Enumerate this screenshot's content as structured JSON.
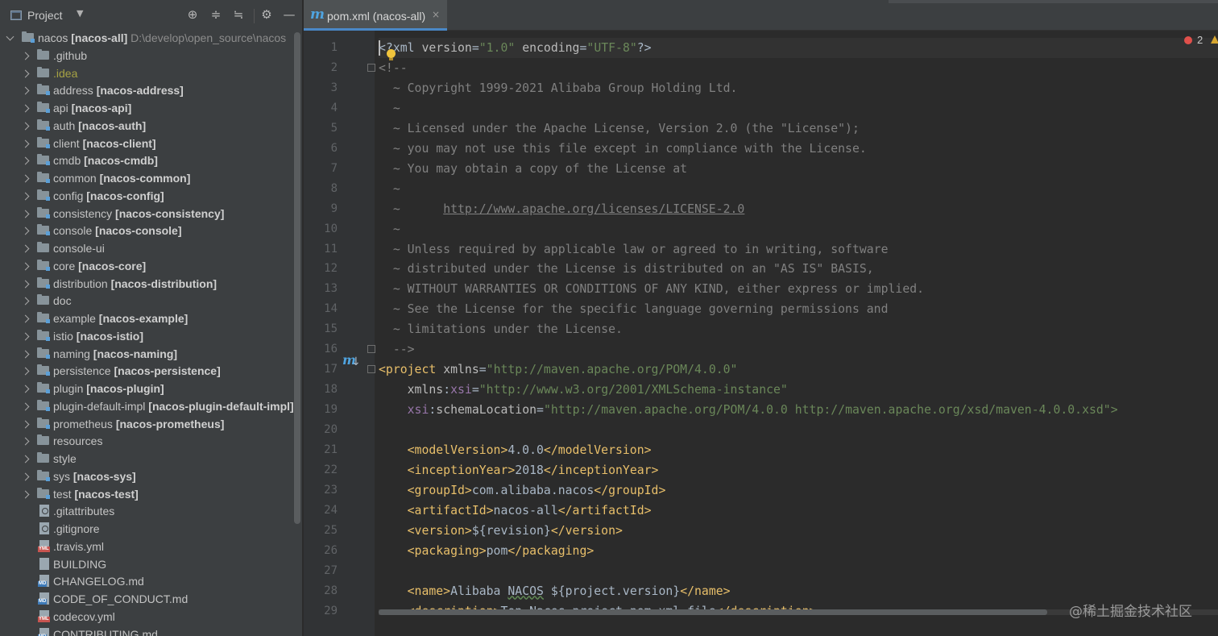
{
  "project_panel": {
    "title": "Project",
    "tools": [
      "locate-icon",
      "expand-all-icon",
      "collapse-all-icon",
      "gear-icon",
      "minimize-icon"
    ],
    "tree": [
      {
        "label": "nacos",
        "module": "[nacos-all]",
        "path": "D:\\develop\\open_source\\nacos",
        "kind": "root"
      },
      {
        "label": ".github",
        "kind": "folder"
      },
      {
        "label": ".idea",
        "kind": "folder-idea"
      },
      {
        "label": "address",
        "module": "[nacos-address]",
        "kind": "module"
      },
      {
        "label": "api",
        "module": "[nacos-api]",
        "kind": "module"
      },
      {
        "label": "auth",
        "module": "[nacos-auth]",
        "kind": "module"
      },
      {
        "label": "client",
        "module": "[nacos-client]",
        "kind": "module"
      },
      {
        "label": "cmdb",
        "module": "[nacos-cmdb]",
        "kind": "module"
      },
      {
        "label": "common",
        "module": "[nacos-common]",
        "kind": "module"
      },
      {
        "label": "config",
        "module": "[nacos-config]",
        "kind": "module"
      },
      {
        "label": "consistency",
        "module": "[nacos-consistency]",
        "kind": "module"
      },
      {
        "label": "console",
        "module": "[nacos-console]",
        "kind": "module"
      },
      {
        "label": "console-ui",
        "kind": "folder"
      },
      {
        "label": "core",
        "module": "[nacos-core]",
        "kind": "module"
      },
      {
        "label": "distribution",
        "module": "[nacos-distribution]",
        "kind": "module"
      },
      {
        "label": "doc",
        "kind": "folder"
      },
      {
        "label": "example",
        "module": "[nacos-example]",
        "kind": "module"
      },
      {
        "label": "istio",
        "module": "[nacos-istio]",
        "kind": "module"
      },
      {
        "label": "naming",
        "module": "[nacos-naming]",
        "kind": "module"
      },
      {
        "label": "persistence",
        "module": "[nacos-persistence]",
        "kind": "module"
      },
      {
        "label": "plugin",
        "module": "[nacos-plugin]",
        "kind": "module"
      },
      {
        "label": "plugin-default-impl",
        "module": "[nacos-plugin-default-impl]",
        "kind": "module"
      },
      {
        "label": "prometheus",
        "module": "[nacos-prometheus]",
        "kind": "module"
      },
      {
        "label": "resources",
        "kind": "folder"
      },
      {
        "label": "style",
        "kind": "folder"
      },
      {
        "label": "sys",
        "module": "[nacos-sys]",
        "kind": "module"
      },
      {
        "label": "test",
        "module": "[nacos-test]",
        "kind": "module"
      },
      {
        "label": ".gitattributes",
        "kind": "file-git"
      },
      {
        "label": ".gitignore",
        "kind": "file-git"
      },
      {
        "label": ".travis.yml",
        "kind": "file-yml"
      },
      {
        "label": "BUILDING",
        "kind": "file"
      },
      {
        "label": "CHANGELOG.md",
        "kind": "file-md"
      },
      {
        "label": "CODE_OF_CONDUCT.md",
        "kind": "file-md"
      },
      {
        "label": "codecov.yml",
        "kind": "file-yml"
      },
      {
        "label": "CONTRIBUTING.md",
        "kind": "file-md"
      }
    ]
  },
  "editor": {
    "tab": {
      "icon": "m",
      "label": "pom.xml (nacos-all)",
      "close": "×"
    },
    "inspections": {
      "errors": "2"
    },
    "watermark": "@稀土掘金技术社区",
    "lines": [
      {
        "n": "1",
        "tokens": [
          {
            "t": "<?xml ",
            "c": "c-text"
          },
          {
            "t": "version",
            "c": "c-attr"
          },
          {
            "t": "=",
            "c": "c-text"
          },
          {
            "t": "\"1.0\"",
            "c": "c-val"
          },
          {
            "t": " ",
            "c": "c-text"
          },
          {
            "t": "encoding",
            "c": "c-attr"
          },
          {
            "t": "=",
            "c": "c-text"
          },
          {
            "t": "\"UTF-8\"",
            "c": "c-val"
          },
          {
            "t": "?>",
            "c": "c-text"
          }
        ]
      },
      {
        "n": "2",
        "tokens": [
          {
            "t": "<!--",
            "c": "c-cmt"
          }
        ]
      },
      {
        "n": "3",
        "tokens": [
          {
            "t": "  ~ Copyright 1999-2021 Alibaba Group Holding Ltd.",
            "c": "c-cmt"
          }
        ]
      },
      {
        "n": "4",
        "tokens": [
          {
            "t": "  ~",
            "c": "c-cmt"
          }
        ]
      },
      {
        "n": "5",
        "tokens": [
          {
            "t": "  ~ Licensed under the Apache License, Version 2.0 (the \"License\");",
            "c": "c-cmt"
          }
        ]
      },
      {
        "n": "6",
        "tokens": [
          {
            "t": "  ~ you may not use this file except in compliance with the License.",
            "c": "c-cmt"
          }
        ]
      },
      {
        "n": "7",
        "tokens": [
          {
            "t": "  ~ You may obtain a copy of the License at",
            "c": "c-cmt"
          }
        ]
      },
      {
        "n": "8",
        "tokens": [
          {
            "t": "  ~",
            "c": "c-cmt"
          }
        ]
      },
      {
        "n": "9",
        "tokens": [
          {
            "t": "  ~      ",
            "c": "c-cmt"
          },
          {
            "t": "http://www.apache.org/licenses/LICENSE-2.0",
            "c": "c-url"
          }
        ]
      },
      {
        "n": "10",
        "tokens": [
          {
            "t": "  ~",
            "c": "c-cmt"
          }
        ]
      },
      {
        "n": "11",
        "tokens": [
          {
            "t": "  ~ Unless required by applicable law or agreed to in writing, software",
            "c": "c-cmt"
          }
        ]
      },
      {
        "n": "12",
        "tokens": [
          {
            "t": "  ~ distributed under the License is distributed on an \"AS IS\" BASIS,",
            "c": "c-cmt"
          }
        ]
      },
      {
        "n": "13",
        "tokens": [
          {
            "t": "  ~ WITHOUT WARRANTIES OR CONDITIONS OF ANY KIND, either express or implied.",
            "c": "c-cmt"
          }
        ]
      },
      {
        "n": "14",
        "tokens": [
          {
            "t": "  ~ See the License for the specific language governing permissions and",
            "c": "c-cmt"
          }
        ]
      },
      {
        "n": "15",
        "tokens": [
          {
            "t": "  ~ limitations under the License.",
            "c": "c-cmt"
          }
        ]
      },
      {
        "n": "16",
        "tokens": [
          {
            "t": "  -->",
            "c": "c-cmt"
          }
        ]
      },
      {
        "n": "17",
        "tokens": [
          {
            "t": "<project ",
            "c": "c-tag"
          },
          {
            "t": "xmlns",
            "c": "c-attr"
          },
          {
            "t": "=",
            "c": "c-text"
          },
          {
            "t": "\"http://maven.apache.org/POM/4.0.0\"",
            "c": "c-val"
          }
        ]
      },
      {
        "n": "18",
        "tokens": [
          {
            "t": "    ",
            "c": "c-text"
          },
          {
            "t": "xmlns",
            "c": "c-attr"
          },
          {
            "t": ":",
            "c": "c-text"
          },
          {
            "t": "xsi",
            "c": "c-ns"
          },
          {
            "t": "=",
            "c": "c-text"
          },
          {
            "t": "\"http://www.w3.org/2001/XMLSchema-instance\"",
            "c": "c-val"
          }
        ]
      },
      {
        "n": "19",
        "tokens": [
          {
            "t": "    ",
            "c": "c-text"
          },
          {
            "t": "xsi",
            "c": "c-ns"
          },
          {
            "t": ":",
            "c": "c-text"
          },
          {
            "t": "schemaLocation",
            "c": "c-attr"
          },
          {
            "t": "=",
            "c": "c-text"
          },
          {
            "t": "\"http://maven.apache.org/POM/4.0.0 http://maven.apache.org/xsd/maven-4.0.0.xsd\">",
            "c": "c-val"
          }
        ]
      },
      {
        "n": "20",
        "tokens": []
      },
      {
        "n": "21",
        "tokens": [
          {
            "t": "    ",
            "c": "c-text"
          },
          {
            "t": "<modelVersion>",
            "c": "c-tag"
          },
          {
            "t": "4.0.0",
            "c": "c-text"
          },
          {
            "t": "</modelVersion>",
            "c": "c-tag"
          }
        ]
      },
      {
        "n": "22",
        "tokens": [
          {
            "t": "    ",
            "c": "c-text"
          },
          {
            "t": "<inceptionYear>",
            "c": "c-tag"
          },
          {
            "t": "2018",
            "c": "c-text"
          },
          {
            "t": "</inceptionYear>",
            "c": "c-tag"
          }
        ]
      },
      {
        "n": "23",
        "tokens": [
          {
            "t": "    ",
            "c": "c-text"
          },
          {
            "t": "<groupId>",
            "c": "c-tag"
          },
          {
            "t": "com.alibaba.nacos",
            "c": "c-text"
          },
          {
            "t": "</groupId>",
            "c": "c-tag"
          }
        ]
      },
      {
        "n": "24",
        "tokens": [
          {
            "t": "    ",
            "c": "c-text"
          },
          {
            "t": "<artifactId>",
            "c": "c-tag"
          },
          {
            "t": "nacos-all",
            "c": "c-text"
          },
          {
            "t": "</artifactId>",
            "c": "c-tag"
          }
        ]
      },
      {
        "n": "25",
        "tokens": [
          {
            "t": "    ",
            "c": "c-text"
          },
          {
            "t": "<version>",
            "c": "c-tag"
          },
          {
            "t": "${revision}",
            "c": "c-text"
          },
          {
            "t": "</version>",
            "c": "c-tag"
          }
        ]
      },
      {
        "n": "26",
        "tokens": [
          {
            "t": "    ",
            "c": "c-text"
          },
          {
            "t": "<packaging>",
            "c": "c-tag"
          },
          {
            "t": "pom",
            "c": "c-text"
          },
          {
            "t": "</packaging>",
            "c": "c-tag"
          }
        ]
      },
      {
        "n": "27",
        "tokens": []
      },
      {
        "n": "28",
        "tokens": [
          {
            "t": "    ",
            "c": "c-text"
          },
          {
            "t": "<name>",
            "c": "c-tag"
          },
          {
            "t": "Alibaba ",
            "c": "c-text"
          },
          {
            "t": "NACOS",
            "c": "c-text c-typo"
          },
          {
            "t": " ${project.version}",
            "c": "c-text"
          },
          {
            "t": "</name>",
            "c": "c-tag"
          }
        ]
      },
      {
        "n": "29",
        "tokens": [
          {
            "t": "    ",
            "c": "c-text"
          },
          {
            "t": "<description>",
            "c": "c-tag"
          },
          {
            "t": "Top ",
            "c": "c-text"
          },
          {
            "t": "Nacos",
            "c": "c-text c-typo"
          },
          {
            "t": " project pom.xml file",
            "c": "c-text"
          },
          {
            "t": "</description>",
            "c": "c-tag"
          }
        ]
      }
    ]
  },
  "colors": {
    "panel_bg": "#3c3f41",
    "editor_bg": "#2b2b2b",
    "tag": "#e8bf6a",
    "string": "#6a8759",
    "comment": "#808080",
    "accent": "#4a88c7"
  }
}
